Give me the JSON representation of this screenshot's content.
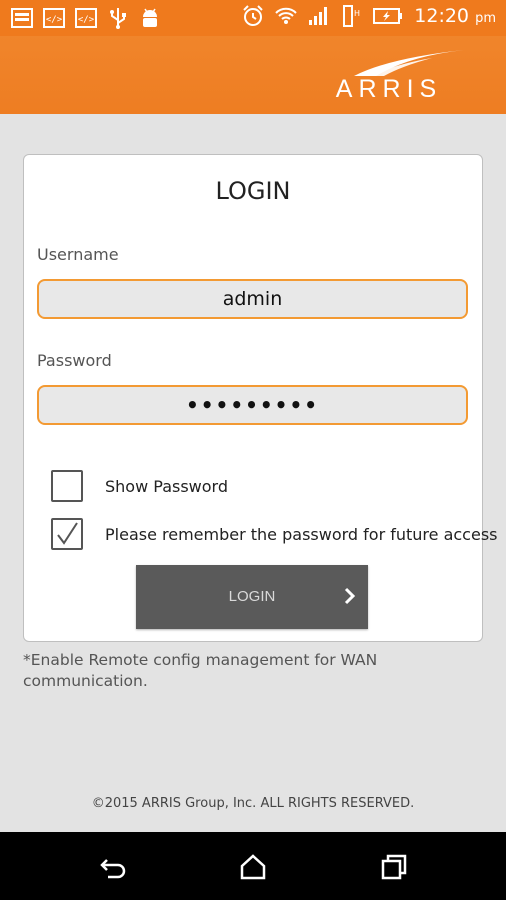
{
  "status_bar": {
    "time": "12:20",
    "ampm": "pm",
    "left_icons": [
      "image-icon",
      "code-icon",
      "code-icon",
      "usb-icon",
      "android-icon"
    ],
    "right_icons": [
      "alarm-icon",
      "wifi-icon",
      "signal-icon",
      "data-icon",
      "battery-charging-icon"
    ]
  },
  "header": {
    "logo_text": "ARRIS",
    "color": "#ef7a1d"
  },
  "login": {
    "title": "LOGIN",
    "username_label": "Username",
    "username_value": "admin",
    "password_label": "Password",
    "password_value": "•••••••••",
    "show_password_label": "Show Password",
    "show_password_checked": false,
    "remember_label": "Please remember the password for future access",
    "remember_checked": true,
    "button_label": "LOGIN"
  },
  "footnote": "*Enable Remote config management for WAN communication.",
  "copyright": "©2015 ARRIS Group, Inc. ALL RIGHTS RESERVED.",
  "nav": {
    "icons": [
      "back-icon",
      "home-icon",
      "recents-icon"
    ]
  }
}
